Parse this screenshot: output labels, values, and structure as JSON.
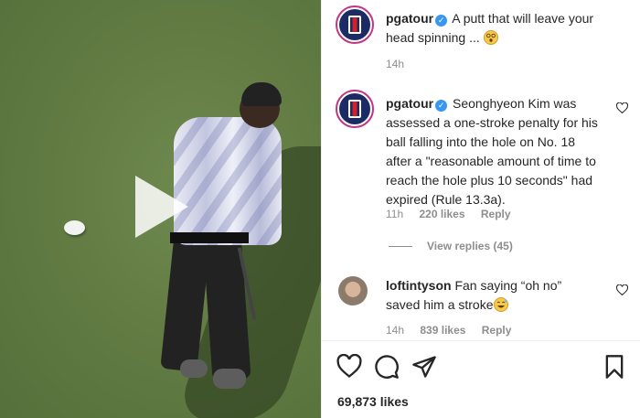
{
  "post": {
    "caption": {
      "username": "pgatour",
      "text": "A putt that will leave your head spinning ...",
      "emoji": "dizzy-face-emoji",
      "time": "14h"
    },
    "likes": "69,873 likes"
  },
  "comments": [
    {
      "username": "pgatour",
      "text": "Seonghyeon Kim was assessed a one-stroke penalty for his ball falling into the hole on No. 18 after a \"reasonable amount of time to reach the hole plus 10 seconds\" had expired (Rule 13.3a).",
      "time": "11h",
      "likes": "220 likes",
      "reply_label": "Reply",
      "view_replies": "View replies (45)"
    },
    {
      "username": "loftintyson",
      "text_line1": "Fan saying “oh no”",
      "text_line2": "saved him a stroke",
      "emoji": "grinning-sweat-emoji",
      "time": "14h",
      "likes": "839 likes",
      "reply_label": "Reply"
    }
  ],
  "icons": {
    "like": "heart-icon",
    "comment": "comment-icon",
    "share": "paper-plane-icon",
    "save": "bookmark-icon",
    "play": "play-icon"
  },
  "colors": {
    "verified": "#3897f0",
    "muted": "#8e8e8e",
    "story_ring": "#c13584"
  }
}
